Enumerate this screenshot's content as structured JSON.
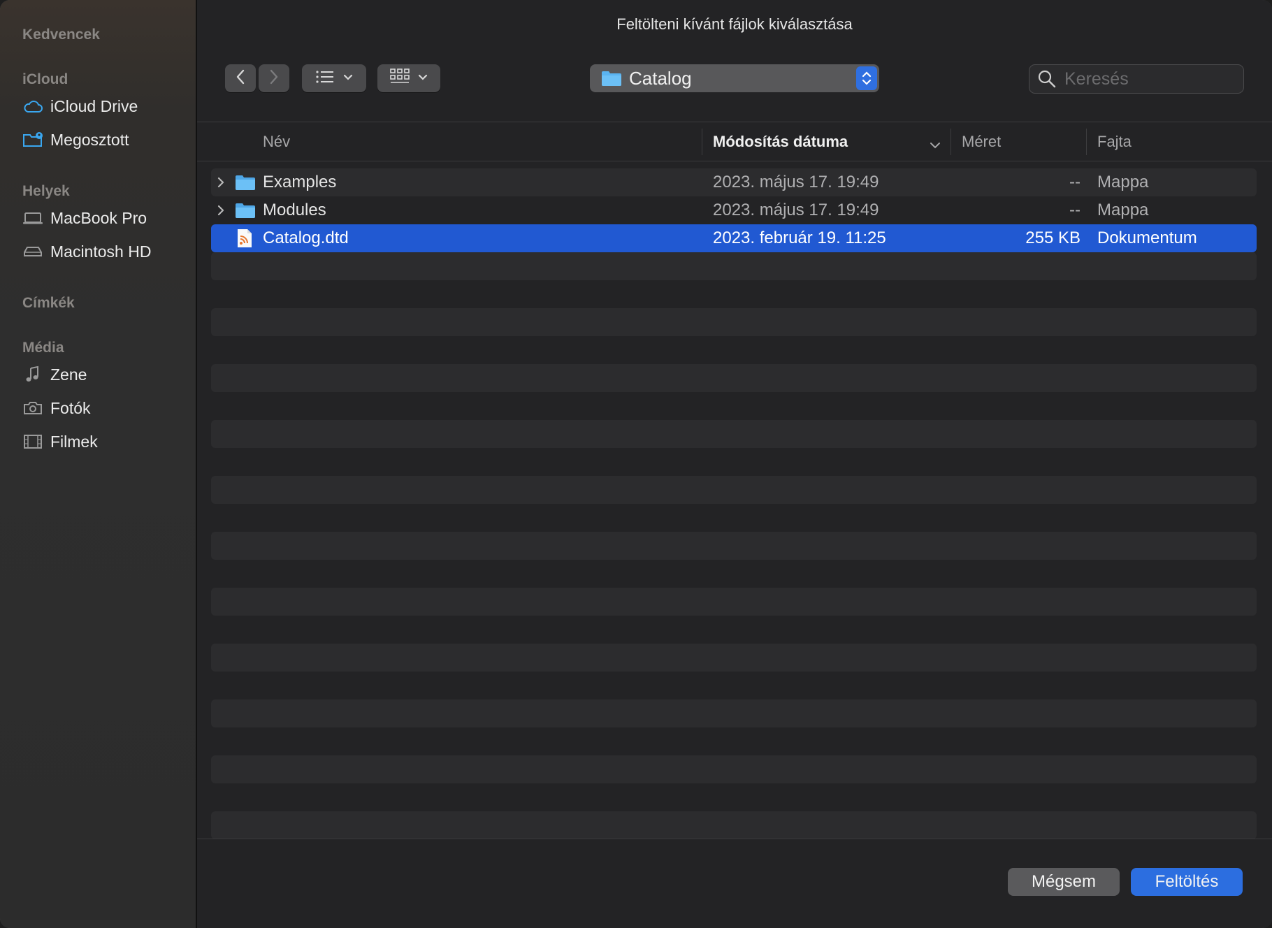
{
  "dialog": {
    "title": "Feltölteni kívánt fájlok kiválasztása"
  },
  "sidebar": {
    "sections": [
      {
        "label": "Kedvencek",
        "items": []
      },
      {
        "label": "iCloud",
        "items": [
          {
            "label": "iCloud Drive",
            "icon": "cloud-icon"
          },
          {
            "label": "Megosztott",
            "icon": "shared-folder-icon"
          }
        ]
      },
      {
        "label": "Helyek",
        "items": [
          {
            "label": "MacBook Pro",
            "icon": "laptop-icon"
          },
          {
            "label": "Macintosh HD",
            "icon": "hard-drive-icon"
          }
        ]
      },
      {
        "label": "Címkék",
        "items": []
      },
      {
        "label": "Média",
        "items": [
          {
            "label": "Zene",
            "icon": "music-note-icon"
          },
          {
            "label": "Fotók",
            "icon": "camera-icon"
          },
          {
            "label": "Filmek",
            "icon": "film-icon"
          }
        ]
      }
    ]
  },
  "toolbar": {
    "location": "Catalog",
    "search_placeholder": "Keresés"
  },
  "table": {
    "columns": {
      "name": "Név",
      "date": "Módosítás dátuma",
      "size": "Méret",
      "kind": "Fajta"
    },
    "sorted_by": "date",
    "rows": [
      {
        "name": "Examples",
        "date": "2023. május 17. 19:49",
        "size": "--",
        "kind": "Mappa",
        "type": "folder",
        "selected": false
      },
      {
        "name": "Modules",
        "date": "2023. május 17. 19:49",
        "size": "--",
        "kind": "Mappa",
        "type": "folder",
        "selected": false
      },
      {
        "name": "Catalog.dtd",
        "date": "2023. február 19. 11:25",
        "size": "255 KB",
        "kind": "Dokumentum",
        "type": "document",
        "selected": true
      }
    ]
  },
  "buttons": {
    "cancel": "Mégsem",
    "upload": "Feltöltés"
  },
  "colors": {
    "accent": "#2159d2",
    "folder": "#5ab3f0",
    "icloud_icon": "#3aa7f0"
  }
}
